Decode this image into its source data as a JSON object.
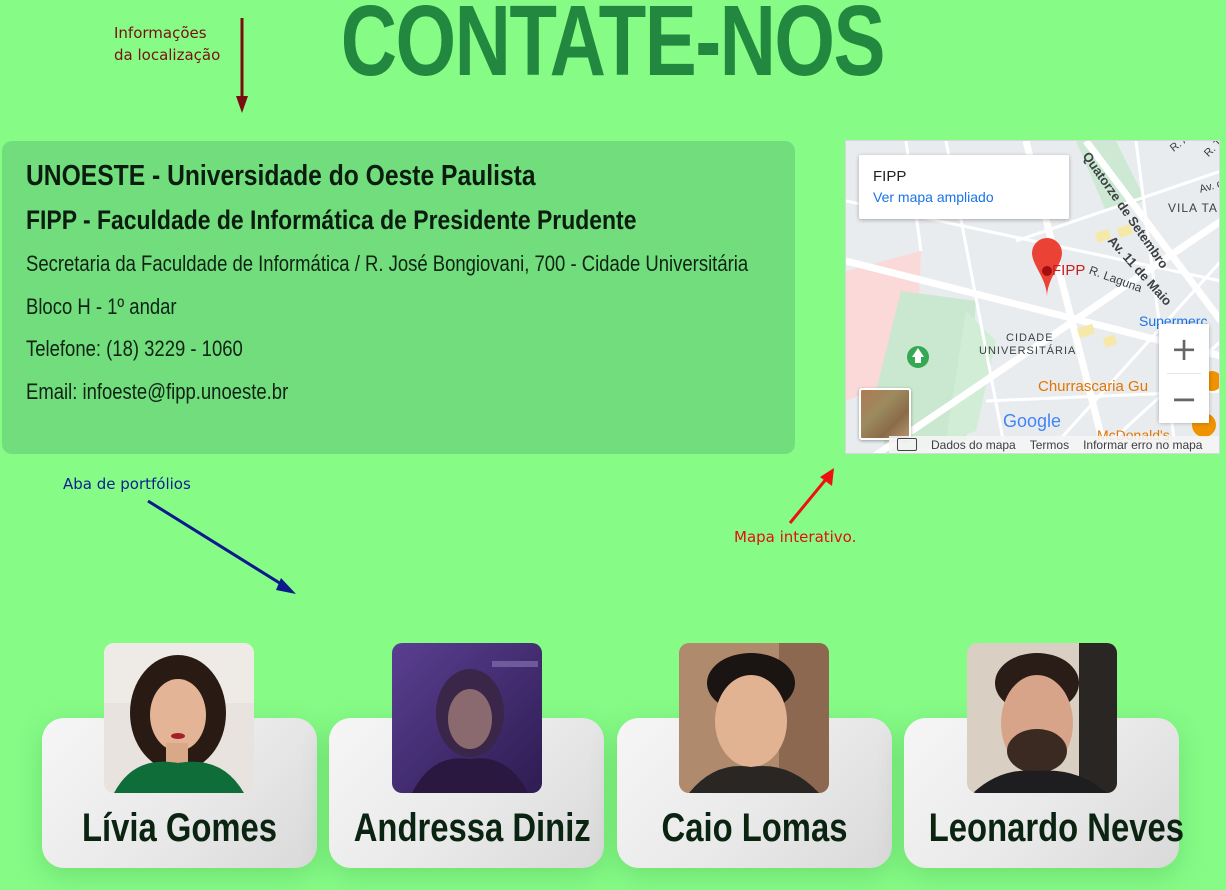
{
  "page": {
    "title": "CONTATE-NOS"
  },
  "annotations": {
    "location": [
      "Informações",
      "da localização"
    ],
    "portfolios": "Aba de portfólios",
    "map": "Mapa interativo."
  },
  "info": {
    "heading1": "UNOESTE - Universidade do Oeste Paulista",
    "heading2": "FIPP - Faculdade de Informática de Presidente Prudente",
    "address": "Secretaria da Faculdade de Informática / R. José Bongiovani, 700 - Cidade Universitária",
    "block": "Bloco H - 1º andar",
    "phone": "Telefone: (18) 3229 - 1060",
    "email": "Email: infoeste@fipp.unoeste.br"
  },
  "map": {
    "place_title": "FIPP",
    "enlarge_link": "Ver mapa ampliado",
    "marker_label": "FIPP",
    "zoom_in": "+",
    "zoom_out": "−",
    "labels": {
      "street1": "Quatorze de Setembro",
      "street2": "Av. 11 de Maio",
      "street3": "R. Laguna",
      "street4": "R. Amap",
      "street5": "R. Tupã",
      "street6": "Av. da",
      "district1": "VILA TA",
      "district2": "CIDADE",
      "district3": "UNIVERSITÁRIA",
      "poi1": "Supermerc",
      "poi2": "Churrascaria Gu",
      "poi3": "McDonald's"
    },
    "google": "Google",
    "footer": {
      "data": "Dados do mapa",
      "terms": "Termos",
      "report": "Informar erro no mapa"
    }
  },
  "people": [
    {
      "name": "Lívia Gomes"
    },
    {
      "name": "Andressa Diniz"
    },
    {
      "name": "Caio Lomas"
    },
    {
      "name": "Leonardo Neves"
    }
  ],
  "colors": {
    "background": "#86fc87",
    "title": "#23883f",
    "card": "#71dd7d",
    "anno_location": "#7a1010",
    "anno_portfolio": "#0c1f8c",
    "anno_map": "#e01010"
  }
}
